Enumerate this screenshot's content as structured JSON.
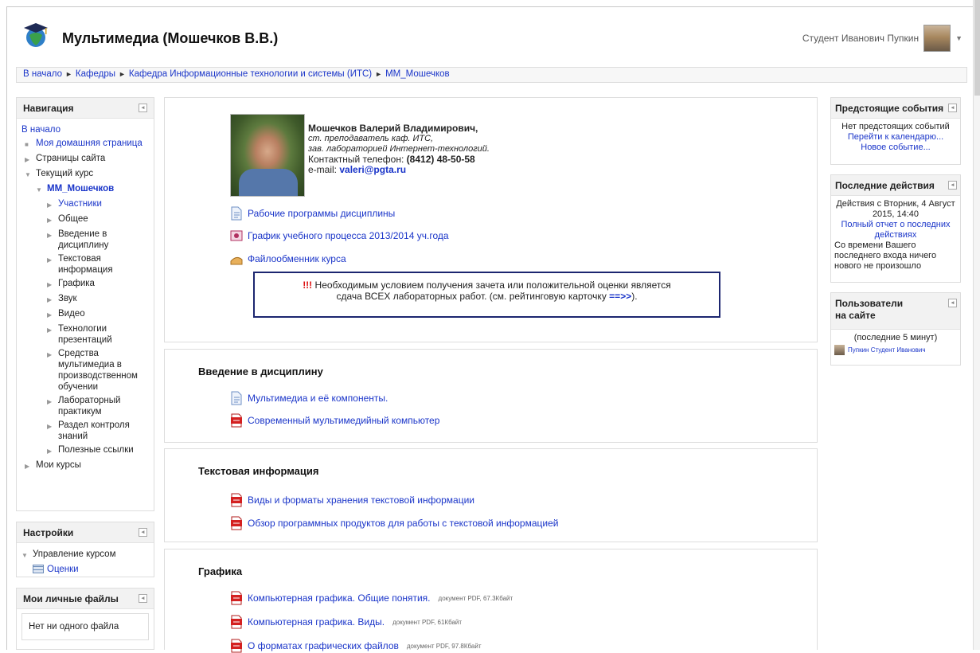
{
  "header": {
    "title": "Мультимедиа (Мошечков В.В.)",
    "user_name": "Студент Иванович Пупкин"
  },
  "breadcrumb": {
    "items": [
      "В начало",
      "Кафедры",
      "Кафедра Информационные технологии и системы (ИТС)",
      "ММ_Мошечков"
    ],
    "sep": "►"
  },
  "navigation": {
    "title": "Навигация",
    "home": "В начало",
    "items": [
      {
        "label": "Моя домашняя страница",
        "mark": "■",
        "link": true
      },
      {
        "label": "Страницы сайта",
        "mark": "▶"
      },
      {
        "label": "Текущий курс",
        "mark": "▼"
      },
      {
        "label": "ММ_Мошечков",
        "mark": "▼",
        "link": true,
        "bold": true
      },
      {
        "label": "Участники",
        "mark": "▶",
        "link": true
      },
      {
        "label": "Общее",
        "mark": "▶"
      },
      {
        "label": "Введение в дисциплину",
        "mark": "▶"
      },
      {
        "label": "Текстовая информация",
        "mark": "▶"
      },
      {
        "label": "Графика",
        "mark": "▶"
      },
      {
        "label": "Звук",
        "mark": "▶"
      },
      {
        "label": "Видео",
        "mark": "▶"
      },
      {
        "label": "Технологии презентаций",
        "mark": "▶"
      },
      {
        "label": "Средства мультимедиа в производственном обучении",
        "mark": "▶"
      },
      {
        "label": "Лабораторный практикум",
        "mark": "▶"
      },
      {
        "label": "Раздел контроля знаний",
        "mark": "▶"
      },
      {
        "label": "Полезные ссылки",
        "mark": "▶"
      },
      {
        "label": "Мои курсы",
        "mark": "▶"
      }
    ]
  },
  "settings": {
    "title": "Настройки",
    "course_admin": "Управление курсом",
    "grades": "Оценки"
  },
  "files": {
    "title": "Мои личные файлы",
    "empty": "Нет ни одного файла"
  },
  "teacher": {
    "name": "Мошечков Валерий Владимирович,",
    "role1": "ст. преподаватель каф. ИТС,",
    "role2": "зав. лабораторией Интернет-технологий.",
    "phone_label": "Контактный телефон:",
    "phone": "(8412) 48-50-58",
    "email_label": "e-mail:",
    "email": "valeri@pgta.ru"
  },
  "intro_resources": [
    "Рабочие программы дисциплины",
    "График учебного процесса 2013/2014 уч.года",
    "Файлообменник курса"
  ],
  "notice": {
    "exclaim": "!!!",
    "line1": "Необходимым условием получения зачета или положительной оценки является",
    "line2": "сдача ВСЕХ лабораторных работ. (см. рейтинговую карточку",
    "link": "==>>",
    "end": ")."
  },
  "sections": [
    {
      "title": "Введение в дисциплину",
      "items": [
        {
          "label": "Мультимедиа и её компоненты."
        },
        {
          "label": "Современный мультимедийный компьютер"
        }
      ]
    },
    {
      "title": "Текстовая информация",
      "items": [
        {
          "label": "Виды и форматы хранения текстовой информации"
        },
        {
          "label": "Обзор программных продуктов для работы с текстовой информацией"
        }
      ]
    },
    {
      "title": "Графика",
      "items": [
        {
          "label": "Компьютерная графика. Общие понятия.",
          "meta": "документ PDF, 67.3Кбайт"
        },
        {
          "label": "Компьютерная графика. Виды.",
          "meta": "документ PDF, 61Кбайт"
        },
        {
          "label": "О форматах графических файлов",
          "meta": "документ PDF, 97.8Кбайт"
        }
      ]
    }
  ],
  "events": {
    "title": "Предстоящие события",
    "none": "Нет предстоящих событий",
    "calendar": "Перейти к календарю...",
    "new": "Новое событие..."
  },
  "recent": {
    "title": "Последние действия",
    "since": "Действия с Вторник, 4 Август 2015, 14:40",
    "full": "Полный отчет о последних действиях",
    "nothing": "Со времени Вашего последнего входа ничего нового не произошло"
  },
  "online": {
    "title": "Пользователи на сайте",
    "period": "(последние 5 минут)",
    "user": "Пупкин Студент Иванович"
  },
  "colors": {
    "link": "#1a35c9",
    "notice_border": "#1c2670",
    "pdf": "#d42020"
  }
}
